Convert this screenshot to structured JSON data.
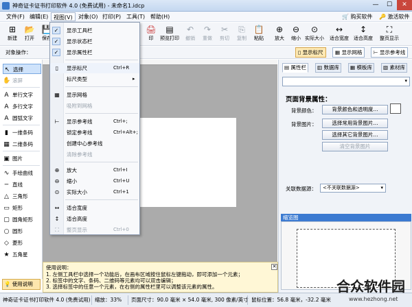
{
  "titlebar": {
    "title": "神奇证卡证书打印软件 4.0 (免费试用) - 未命名1.idcp",
    "min": "—",
    "max": "☐",
    "close": "✕"
  },
  "menus": [
    "文件(F)",
    "编辑(E)",
    "视图(V)",
    "对象(O)",
    "打印(P)",
    "工具(T)",
    "帮助(H)"
  ],
  "promo": {
    "buy": "购买软件",
    "activate": "激活软件"
  },
  "toolbar": [
    {
      "icon": "⊞",
      "label": "新建"
    },
    {
      "icon": "📂",
      "label": "打开"
    },
    {
      "icon": "💾",
      "label": "保存"
    },
    {
      "icon": "🖨",
      "label": "打印"
    },
    {
      "icon": "↶",
      "label": "撤销"
    },
    {
      "icon": "↷",
      "label": "重做"
    },
    {
      "icon": "✂",
      "label": "剪切"
    },
    {
      "icon": "⎘",
      "label": "复制"
    },
    {
      "icon": "📋",
      "label": "粘贴"
    },
    {
      "icon": "⊟",
      "label": "删除"
    },
    {
      "icon": "⊕",
      "label": "放大"
    },
    {
      "icon": "⊖",
      "label": "缩小"
    },
    {
      "icon": "⊙",
      "label": "实际大小"
    },
    {
      "icon": "↔",
      "label": "适合宽度"
    },
    {
      "icon": "↕",
      "label": "适合高度"
    },
    {
      "icon": "⛶",
      "label": "整页显示"
    }
  ],
  "toolbar_partial": {
    "print_label": "印",
    "print_preview": "预览打印"
  },
  "toolbar2": {
    "object_ops": "对象操作：",
    "show_ruler": "显示标尺",
    "show_grid": "显示网格",
    "show_guides": "显示参考线"
  },
  "lefttools": {
    "items": [
      "选择",
      "滚屏",
      "单行文字",
      "多行文字",
      "圆弧文字",
      "一维条码",
      "二维条码",
      "图片",
      "手绘曲线",
      "直线",
      "三角形",
      "矩形",
      "圆角矩形",
      "圆形",
      "菱形",
      "五角星"
    ],
    "icons": [
      "↖",
      "✋",
      "A",
      "A",
      "A",
      "▮",
      "▦",
      "▣",
      "∿",
      "─",
      "△",
      "▭",
      "▢",
      "○",
      "◇",
      "★"
    ]
  },
  "view_menu": {
    "items": [
      {
        "label": "显示工具栏",
        "checked": true,
        "shortcut": ""
      },
      {
        "label": "显示状态栏",
        "checked": true,
        "shortcut": ""
      },
      {
        "label": "显示属性栏",
        "checked": true,
        "shortcut": ""
      },
      {
        "label": "显示标尺",
        "shortcut": "Ctrl+R",
        "icon": "▯"
      },
      {
        "label": "标尺类型",
        "shortcut": "",
        "submenu": "▸"
      },
      {
        "label": "显示网格",
        "shortcut": "",
        "icon": "▦"
      },
      {
        "label": "吸附到网格",
        "shortcut": "",
        "disabled": true
      },
      {
        "label": "显示参考线",
        "shortcut": "Ctrl+;",
        "icon": "⊢"
      },
      {
        "label": "锁定参考线",
        "shortcut": "Ctrl+Alt+;"
      },
      {
        "label": "创建中心参考线",
        "shortcut": ""
      },
      {
        "label": "清除参考线",
        "shortcut": "",
        "disabled": true
      },
      {
        "label": "放大",
        "shortcut": "Ctrl+I",
        "icon": "⊕"
      },
      {
        "label": "缩小",
        "shortcut": "Ctrl+U",
        "icon": "⊖"
      },
      {
        "label": "实际大小",
        "shortcut": "Ctrl+1",
        "icon": "⊙"
      },
      {
        "label": "适合宽度",
        "shortcut": "",
        "icon": "↔"
      },
      {
        "label": "适合高度",
        "shortcut": "",
        "icon": "↕"
      },
      {
        "label": "整页显示",
        "shortcut": "Ctrl+0",
        "icon": "⛶",
        "disabled": true
      }
    ]
  },
  "rightpanel": {
    "tabs": [
      "属性栏",
      "数据库",
      "模板库",
      "素材库"
    ],
    "prop_title": "页面背景属性：",
    "bg_color_label": "背景颜色：",
    "bg_color_btn": "背景颜色和透明度...",
    "bg_image_label": "背景图片：",
    "btn_common_bg": "选择常用背景图片...",
    "btn_other_bg": "选择其它背景图片...",
    "btn_clear_bg": "清空背景图片",
    "assoc_label": "关联数据源：",
    "assoc_value": "<不关联数据源>",
    "preview_title": "缩览图"
  },
  "help": {
    "title": "使用说明：",
    "lines": [
      "1. 左侧工具栏中选择一个功能后，在画布区域按住鼠标左键拖动，即可添加一个元素；",
      "2. 标签中的文字、条码、二维码等元素均可以双击编辑；",
      "3. 选择标签中的任意一个元素，在右侧的属性栏里可以调整该元素的属性。"
    ],
    "close": "✕",
    "usage_btn": "使用说明"
  },
  "status": {
    "app": "神奇证卡证书打印软件 4.0 (免费试用)",
    "zoom": "缩放：33%",
    "size": "页面尺寸：90.0 毫米 × 54.0 毫米, 300 像素/英寸",
    "pos": "鼠标位置：56.8 毫米，-32.2 毫米"
  },
  "watermark": {
    "text": "合众软件园",
    "url": "www.hezhong.net"
  },
  "colors": {
    "accent": "#3b7ad1",
    "highlight": "#fde9b4"
  }
}
